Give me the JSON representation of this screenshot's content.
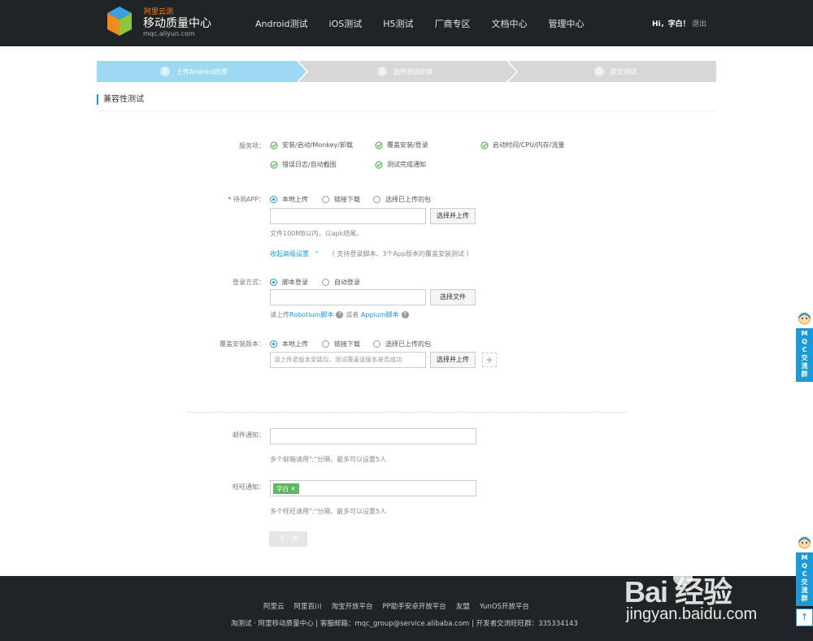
{
  "header": {
    "brand_top": "阿里云测",
    "brand_name": "移动质量中心",
    "brand_url": "mqc.aliyun.com",
    "nav": [
      "Android测试",
      "iOS测试",
      "H5测试",
      "厂商专区",
      "文档中心",
      "管理中心"
    ],
    "greeting": "Hi，字白！",
    "logout": "退出"
  },
  "steps": [
    {
      "num": "1",
      "label": "上传Android应用",
      "active": true
    },
    {
      "num": "2",
      "label": "选择测试终端",
      "active": false
    },
    {
      "num": "3",
      "label": "提交测试",
      "active": false
    }
  ],
  "section_title": "兼容性测试",
  "services": {
    "label": "服务项：",
    "items": [
      "安装/启动/Monkey/卸载",
      "覆盖安装/登录",
      "启动时间/CPU/内存/流量",
      "错误日志/自动截图",
      "测试完成通知"
    ]
  },
  "app": {
    "required": "*",
    "label": "待测APP：",
    "options": [
      "本地上传",
      "链接下载",
      "选择已上传的包"
    ],
    "button": "选择并上传",
    "hint": "文件100MB以内，以apk结尾。",
    "advanced_link": "收起高级设置",
    "advanced_note": "（ 支持登录脚本、3个App版本的覆盖安装测试 ）"
  },
  "login": {
    "label": "登录方式：",
    "options": [
      "脚本登录",
      "自动登录"
    ],
    "button": "选择文件",
    "hint_prefix": "请上传",
    "robotium": "Robotium脚本",
    "hint_or": "或者",
    "appium": "Appium脚本"
  },
  "cover": {
    "label": "覆盖安装版本：",
    "options": [
      "本地上传",
      "链接下载",
      "选择已上传的包"
    ],
    "placeholder": "请上传老版本安装包，测试覆盖该版本是否成功",
    "button": "选择并上传",
    "add": "+"
  },
  "mail": {
    "label": "邮件通知：",
    "hint": "多个邮箱请用\";\"分隔，最多可以设置5人"
  },
  "wangwang": {
    "label": "旺旺通知：",
    "tag": "字白 ✕",
    "hint": "多个旺旺请用\";\"分隔，最多可以设置5人"
  },
  "next_button": "下一步",
  "footer": {
    "links": [
      "阿里云",
      "阿里百川",
      "淘宝开放平台",
      "PP助手安卓开放平台",
      "友盟",
      "YunOS开放平台"
    ],
    "info": "淘测试 · 阿里移动质量中心 | 客服邮箱：mqc_group@service.alibaba.com | 开发者交流旺旺群：335334143"
  },
  "side": {
    "label": "MQC交流群",
    "top": "↑"
  },
  "watermark": {
    "logo": "Bai  经验",
    "url": "jingyan.baidu.com"
  },
  "colors": {
    "accent": "#1a9bd7",
    "step_active": "#9ed8f1",
    "step_inactive": "#d7d7d7",
    "header_bg": "#1f2426",
    "check": "#5cb85c"
  }
}
